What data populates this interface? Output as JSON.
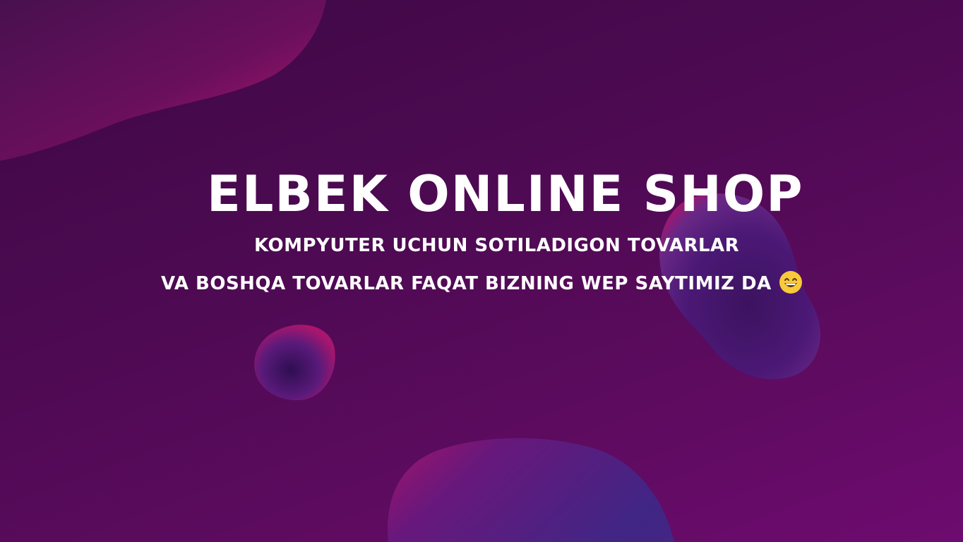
{
  "hero": {
    "title": "ELBEK ONLINE SHOP",
    "line1": "KOMPYUTER UCHUN SOTILADIGON TOVARLAR",
    "line2": "VA BOSHQA TOVARLAR FAQAT BIZNING WEP SAYTIMIZ DA",
    "emoji": "grinning-face-with-smiling-eyes"
  },
  "colors": {
    "background_dark": "#3e0844",
    "background_light": "#6e0b70",
    "blob_pink": "#b0156f",
    "blob_blue": "#3b2a8a",
    "text": "#ffffff",
    "emoji_yellow": "#f8c93a"
  }
}
